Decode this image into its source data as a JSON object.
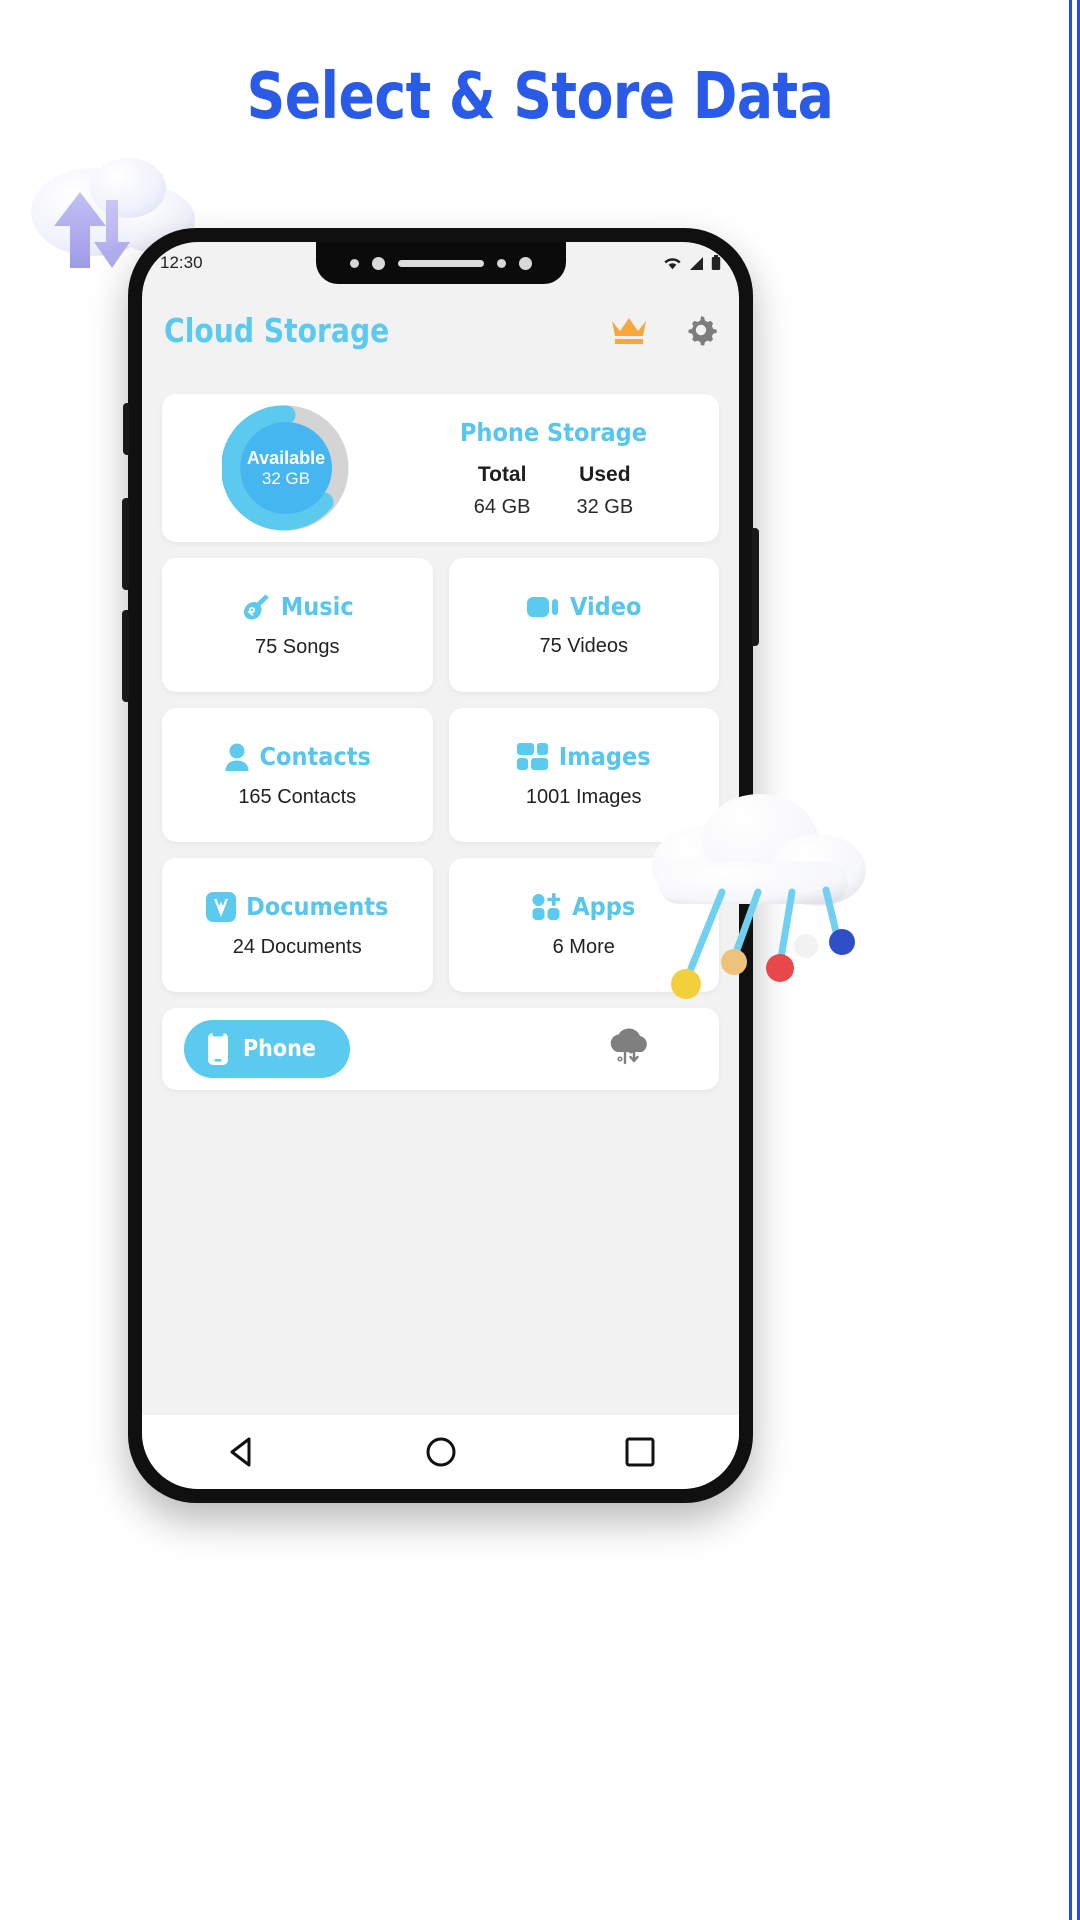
{
  "page": {
    "title": "Select & Store Data",
    "title_color": "#2a5ae8",
    "accent_color": "#5cc9ee",
    "crown_color": "#f5a93c"
  },
  "statusbar": {
    "time": "12:30",
    "icons": [
      "wifi-icon",
      "signal-icon",
      "battery-icon"
    ]
  },
  "appbar": {
    "title": "Cloud Storage",
    "premium_icon": "crown-icon",
    "settings_icon": "gear-icon"
  },
  "storage": {
    "donut": {
      "center_label": "Available",
      "center_value": "32 GB",
      "available_pct": 50,
      "arc_color": "#5cc9ee",
      "track_color": "#d4d4d4",
      "inner_color": "#46b6f0"
    },
    "heading": "Phone Storage",
    "stats": [
      {
        "key": "Total",
        "value": "64 GB"
      },
      {
        "key": "Used",
        "value": "32 GB"
      }
    ]
  },
  "categories": [
    {
      "name": "Music",
      "count": "75 Songs",
      "icon": "guitar-icon"
    },
    {
      "name": "Video",
      "count": "75 Videos",
      "icon": "video-camera-icon"
    },
    {
      "name": "Contacts",
      "count": "165 Contacts",
      "icon": "person-icon"
    },
    {
      "name": "Images",
      "count": "1001 Images",
      "icon": "image-grid-icon"
    },
    {
      "name": "Documents",
      "count": "24 Documents",
      "icon": "document-pen-icon"
    },
    {
      "name": "Apps",
      "count": "6 More",
      "icon": "apps-plus-icon"
    }
  ],
  "tabbar": {
    "tabs": [
      {
        "label": "Phone",
        "icon": "phone-icon",
        "active": true
      },
      {
        "label": "",
        "icon": "cloud-sync-icon",
        "active": false
      }
    ]
  },
  "navbar": {
    "buttons": [
      {
        "name": "back-button",
        "icon": "triangle-back-icon"
      },
      {
        "name": "home-button",
        "icon": "circle-home-icon"
      },
      {
        "name": "recents-button",
        "icon": "square-recents-icon"
      }
    ]
  }
}
